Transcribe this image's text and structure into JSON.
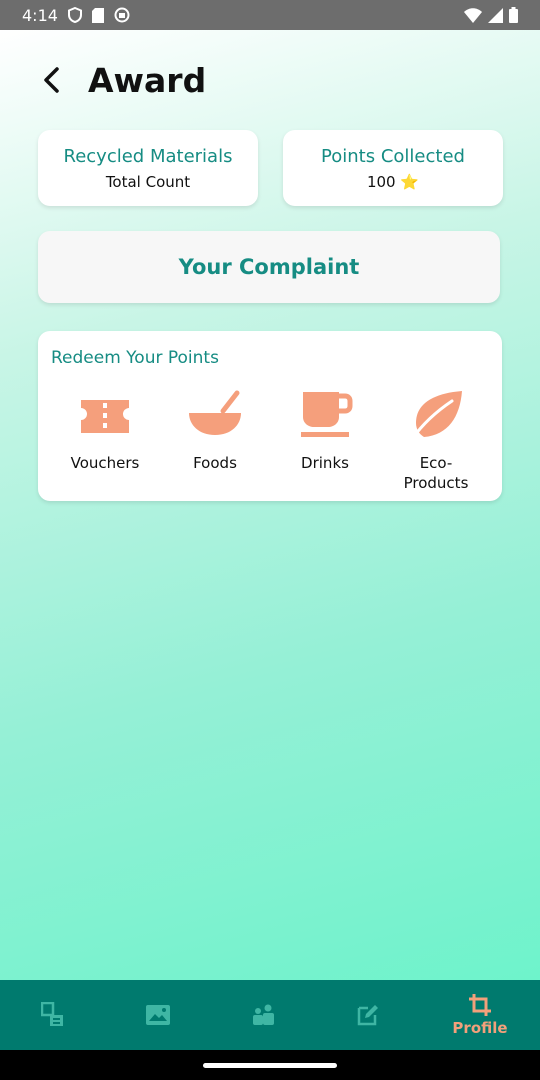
{
  "status_bar": {
    "time": "4:14"
  },
  "header": {
    "title": "Award"
  },
  "stats": {
    "recycled": {
      "title": "Recycled Materials",
      "value": "Total Count"
    },
    "points": {
      "title": "Points Collected",
      "value": "100 ⭐"
    }
  },
  "complaint": {
    "label": "Your Complaint"
  },
  "redeem": {
    "title": "Redeem Your Points",
    "items": [
      {
        "label": "Vouchers",
        "icon": "ticket-icon"
      },
      {
        "label": "Foods",
        "icon": "bowl-icon"
      },
      {
        "label": "Drinks",
        "icon": "cup-icon"
      },
      {
        "label": "Eco-Products",
        "icon": "leaf-icon"
      }
    ]
  },
  "bottom_nav": {
    "items": [
      {
        "icon": "devices-icon",
        "label": ""
      },
      {
        "icon": "image-icon",
        "label": ""
      },
      {
        "icon": "people-icon",
        "label": ""
      },
      {
        "icon": "edit-icon",
        "label": ""
      },
      {
        "icon": "crop-icon",
        "label": "Profile"
      }
    ]
  },
  "colors": {
    "accent": "#168c83",
    "icon_orange": "#f59f7c",
    "nav_bg": "#007a6e",
    "nav_active": "#f2a07b",
    "nav_inactive": "#3fb6a4"
  }
}
